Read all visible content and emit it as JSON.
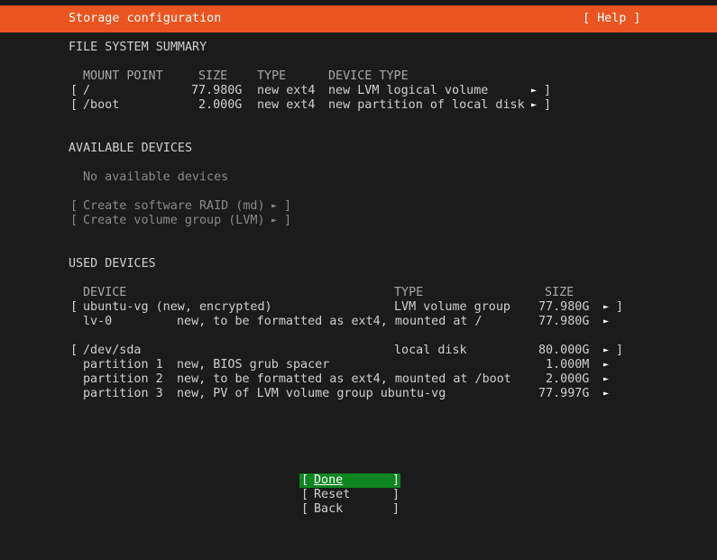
{
  "header": {
    "title": "Storage configuration",
    "help": "[ Help ]"
  },
  "fs_summary": {
    "title": "FILE SYSTEM SUMMARY",
    "columns": {
      "mount": "MOUNT POINT",
      "size": "SIZE",
      "type": "TYPE",
      "device_type": "DEVICE TYPE"
    },
    "rows": [
      {
        "open": "[",
        "mount": "/",
        "size": "77.980G",
        "type": "new ext4",
        "device_type": "new LVM logical volume",
        "arrow": "►",
        "close": "]"
      },
      {
        "open": "[",
        "mount": "/boot",
        "size": "2.000G",
        "type": "new ext4",
        "device_type": "new partition of local disk",
        "arrow": "►",
        "close": "]"
      }
    ]
  },
  "available": {
    "title": "AVAILABLE DEVICES",
    "empty": "No available devices",
    "actions": [
      {
        "open": "[",
        "label": "Create software RAID (md)",
        "arrow": "►",
        "close": "]"
      },
      {
        "open": "[",
        "label": "Create volume group (LVM)",
        "arrow": "►",
        "close": "]"
      }
    ]
  },
  "used": {
    "title": "USED DEVICES",
    "columns": {
      "device": "DEVICE",
      "type": "TYPE",
      "size": "SIZE"
    },
    "groups": [
      {
        "open": "[",
        "name": "ubuntu-vg (new, encrypted)",
        "type": "LVM volume group",
        "size": "77.980G",
        "arrow": "►",
        "close": "]",
        "children": [
          {
            "name": "lv-0",
            "desc": "new, to be formatted as ext4, mounted at /",
            "size": "77.980G",
            "arrow": "►"
          }
        ]
      },
      {
        "open": "[",
        "name": "/dev/sda",
        "type": "local disk",
        "size": "80.000G",
        "arrow": "►",
        "close": "]",
        "children": [
          {
            "name": "partition 1",
            "desc": "new, BIOS grub spacer",
            "size": "1.000M",
            "arrow": "►"
          },
          {
            "name": "partition 2",
            "desc": "new, to be formatted as ext4, mounted at /boot",
            "size": "2.000G",
            "arrow": "►"
          },
          {
            "name": "partition 3",
            "desc": "new, PV of LVM volume group ubuntu-vg",
            "size": "77.997G",
            "arrow": "►"
          }
        ]
      }
    ]
  },
  "buttons": {
    "done": {
      "open": "[",
      "label": "Done",
      "close": "]"
    },
    "reset": {
      "open": "[",
      "label": "Reset",
      "close": "]"
    },
    "back": {
      "open": "[",
      "label": "Back",
      "close": "]"
    }
  },
  "colors": {
    "header_bg": "#e95420",
    "focus_bg": "#0e8420",
    "background": "#1b1b1b"
  }
}
